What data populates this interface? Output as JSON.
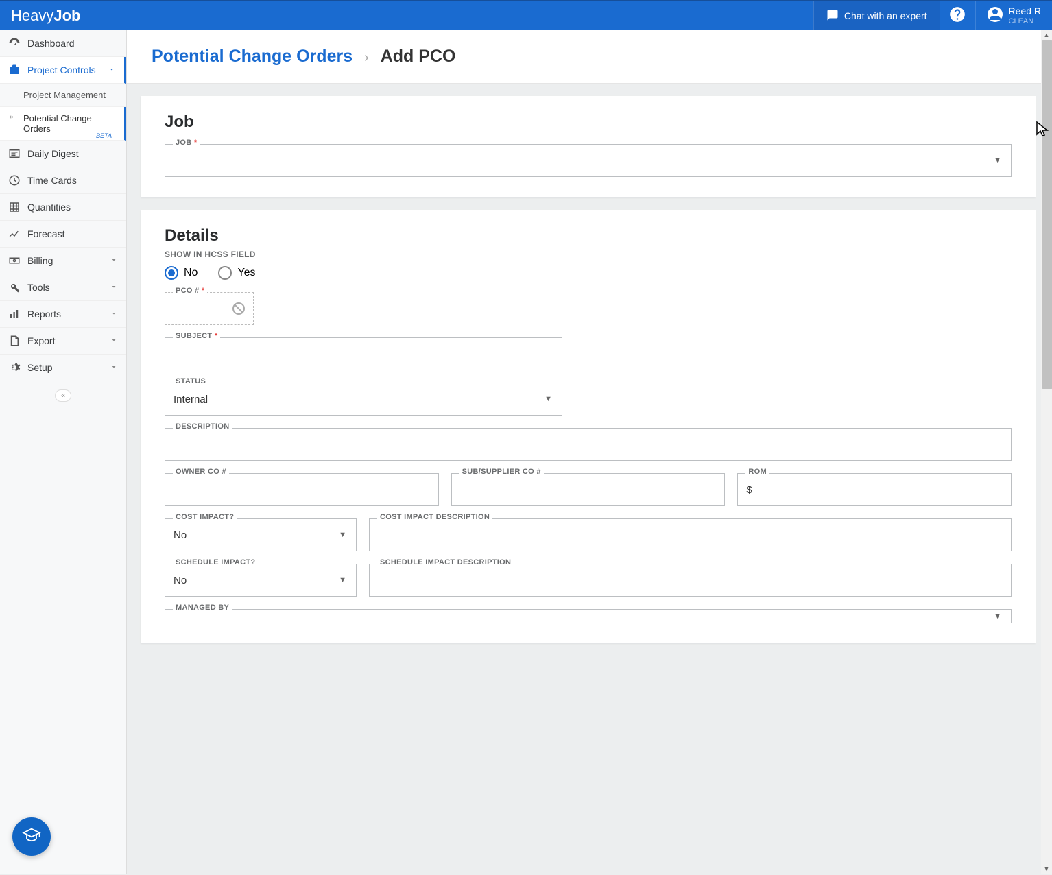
{
  "app": {
    "logo_part1": "Heavy",
    "logo_part2": "Job"
  },
  "header": {
    "chat_label": "Chat with an expert",
    "user_name": "Reed R",
    "user_sub": "CLEAN"
  },
  "sidebar": {
    "items": [
      {
        "label": "Dashboard"
      },
      {
        "label": "Project Controls"
      },
      {
        "label": "Daily Digest"
      },
      {
        "label": "Time Cards"
      },
      {
        "label": "Quantities"
      },
      {
        "label": "Forecast"
      },
      {
        "label": "Billing"
      },
      {
        "label": "Tools"
      },
      {
        "label": "Reports"
      },
      {
        "label": "Export"
      },
      {
        "label": "Setup"
      }
    ],
    "sub_items": {
      "project_management": "Project Management",
      "pco": "Potential Change Orders",
      "beta": "BETA"
    }
  },
  "breadcrumbs": {
    "link": "Potential Change Orders",
    "current": "Add PCO"
  },
  "panels": {
    "job": {
      "title": "Job",
      "field_label": "JOB"
    },
    "details": {
      "title": "Details",
      "show_in_field": "SHOW IN HCSS FIELD",
      "radio_no": "No",
      "radio_yes": "Yes",
      "pco_num_label": "PCO #",
      "subject_label": "SUBJECT",
      "status_label": "STATUS",
      "status_value": "Internal",
      "description_label": "DESCRIPTION",
      "owner_co_label": "OWNER CO #",
      "sub_supplier_label": "SUB/SUPPLIER CO #",
      "rom_label": "ROM",
      "rom_prefix": "$",
      "cost_impact_label": "COST IMPACT?",
      "cost_impact_value": "No",
      "cost_impact_desc_label": "COST IMPACT DESCRIPTION",
      "schedule_impact_label": "SCHEDULE IMPACT?",
      "schedule_impact_value": "No",
      "schedule_impact_desc_label": "SCHEDULE IMPACT DESCRIPTION",
      "managed_by_label": "MANAGED BY"
    }
  }
}
